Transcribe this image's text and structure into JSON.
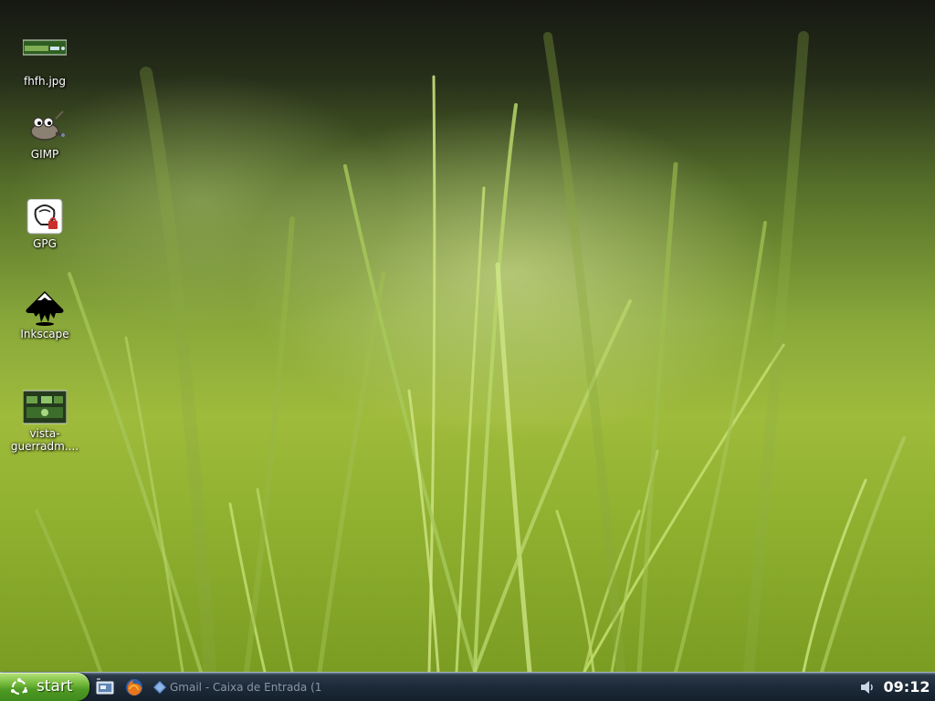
{
  "desktop": {
    "icons": [
      {
        "label": "fhfh.jpg",
        "icon": "image-thumbnail-icon"
      },
      {
        "label": "GIMP",
        "icon": "gimp-icon"
      },
      {
        "label": "GPG",
        "icon": "gpg-icon"
      },
      {
        "label": "Inkscape",
        "icon": "inkscape-icon"
      },
      {
        "label": "vista-\nguerradm....",
        "icon": "image-thumbnail-icon"
      }
    ]
  },
  "taskbar": {
    "start_label": "start",
    "quick_launch": [
      {
        "icon": "show-desktop-icon"
      },
      {
        "icon": "firefox-icon"
      }
    ],
    "tasks": [
      {
        "label": "Gmail - Caixa de Entrada (1",
        "icon": "diamond-app-icon"
      }
    ],
    "tray": {
      "volume_icon": "speaker-icon",
      "clock": "09:12"
    }
  },
  "colors": {
    "start_green": "#4f9a24",
    "taskbar_dark": "#1d2a38",
    "wallpaper_green": "#8fb02f"
  }
}
